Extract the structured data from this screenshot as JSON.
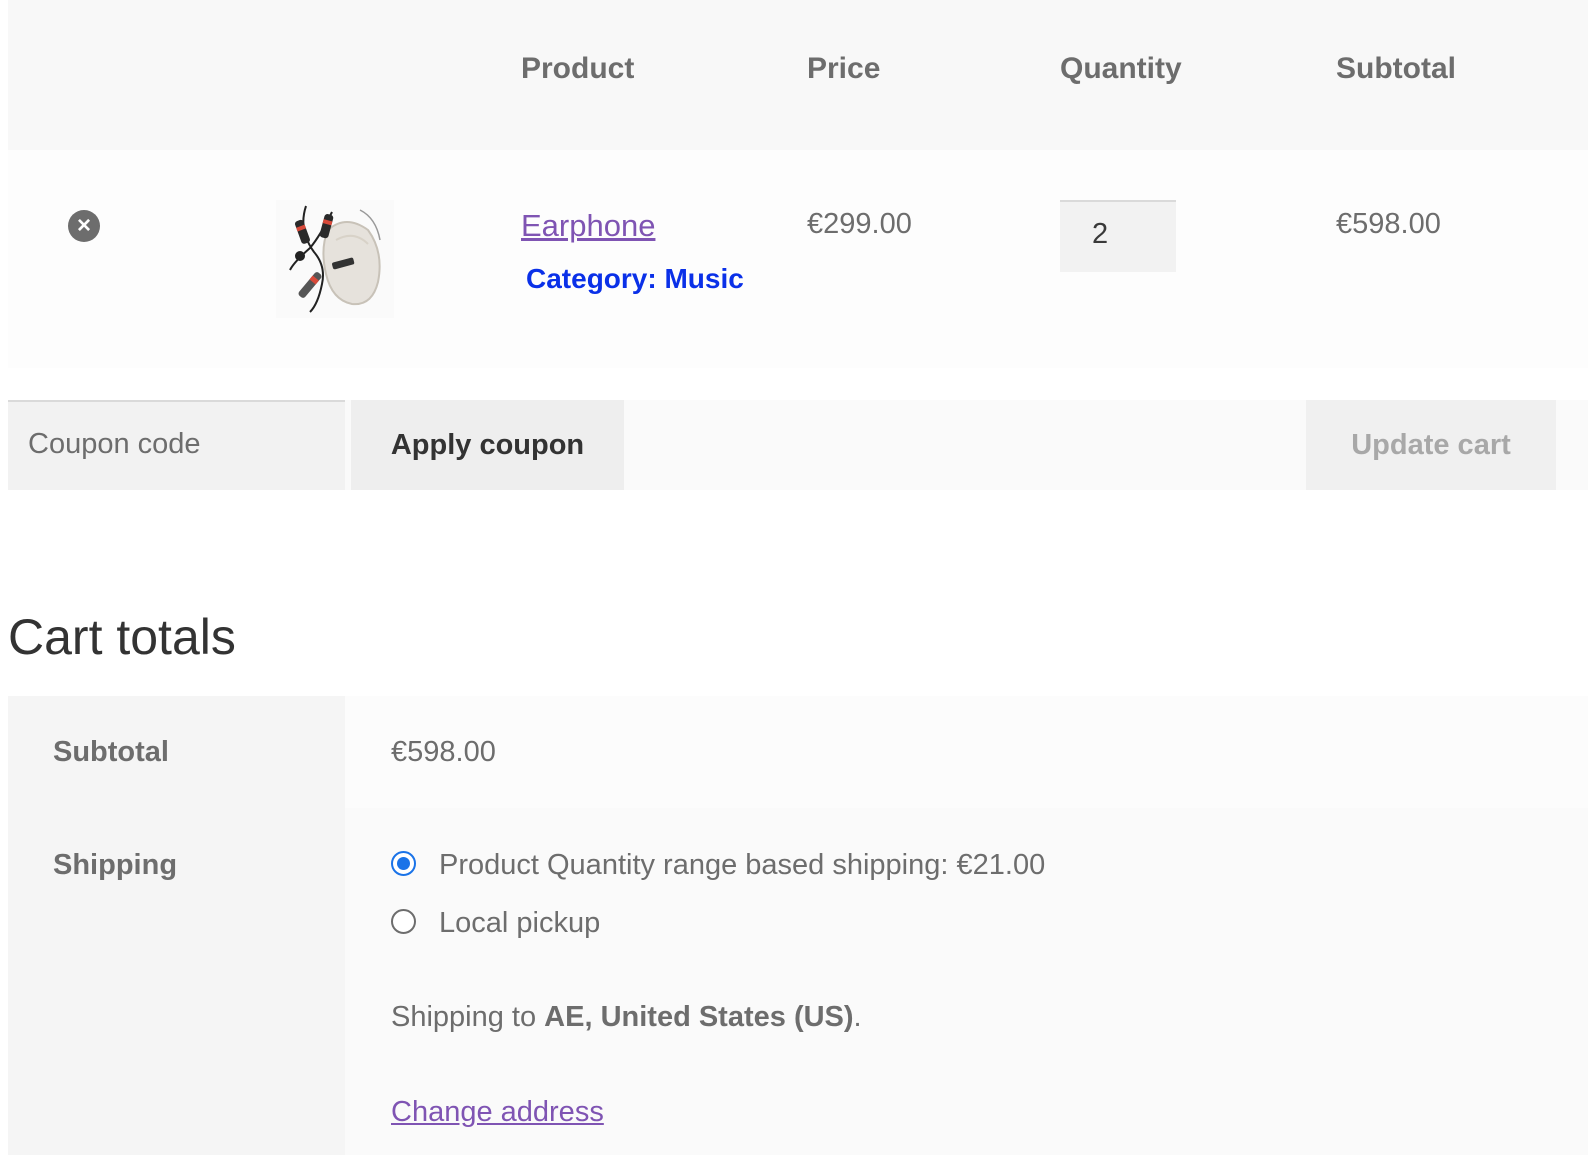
{
  "cart_table": {
    "headers": {
      "product": "Product",
      "price": "Price",
      "quantity": "Quantity",
      "subtotal": "Subtotal"
    },
    "items": [
      {
        "remove_icon": "close-circle-icon",
        "thumbnail": "earphone-product-image",
        "name": "Earphone",
        "category": "Category: Music",
        "price": "€299.00",
        "quantity": "2",
        "subtotal": "€598.00"
      }
    ]
  },
  "actions": {
    "coupon_placeholder": "Coupon code",
    "apply_coupon_label": "Apply coupon",
    "update_cart_label": "Update cart"
  },
  "cart_totals": {
    "title": "Cart totals",
    "subtotal_label": "Subtotal",
    "subtotal_value": "€598.00",
    "shipping_label": "Shipping",
    "shipping_options": [
      {
        "label": "Product Quantity range based shipping: €21.00",
        "selected": true
      },
      {
        "label": "Local pickup",
        "selected": false
      }
    ],
    "shipping_to_prefix": "Shipping to ",
    "shipping_to_location": "AE, United States (US)",
    "shipping_to_suffix": ".",
    "change_address_label": "Change address"
  },
  "colors": {
    "link": "#7f54b3",
    "category": "#0a30e8",
    "radio_selected": "#1a73e8",
    "text": "#6d6d6d"
  }
}
